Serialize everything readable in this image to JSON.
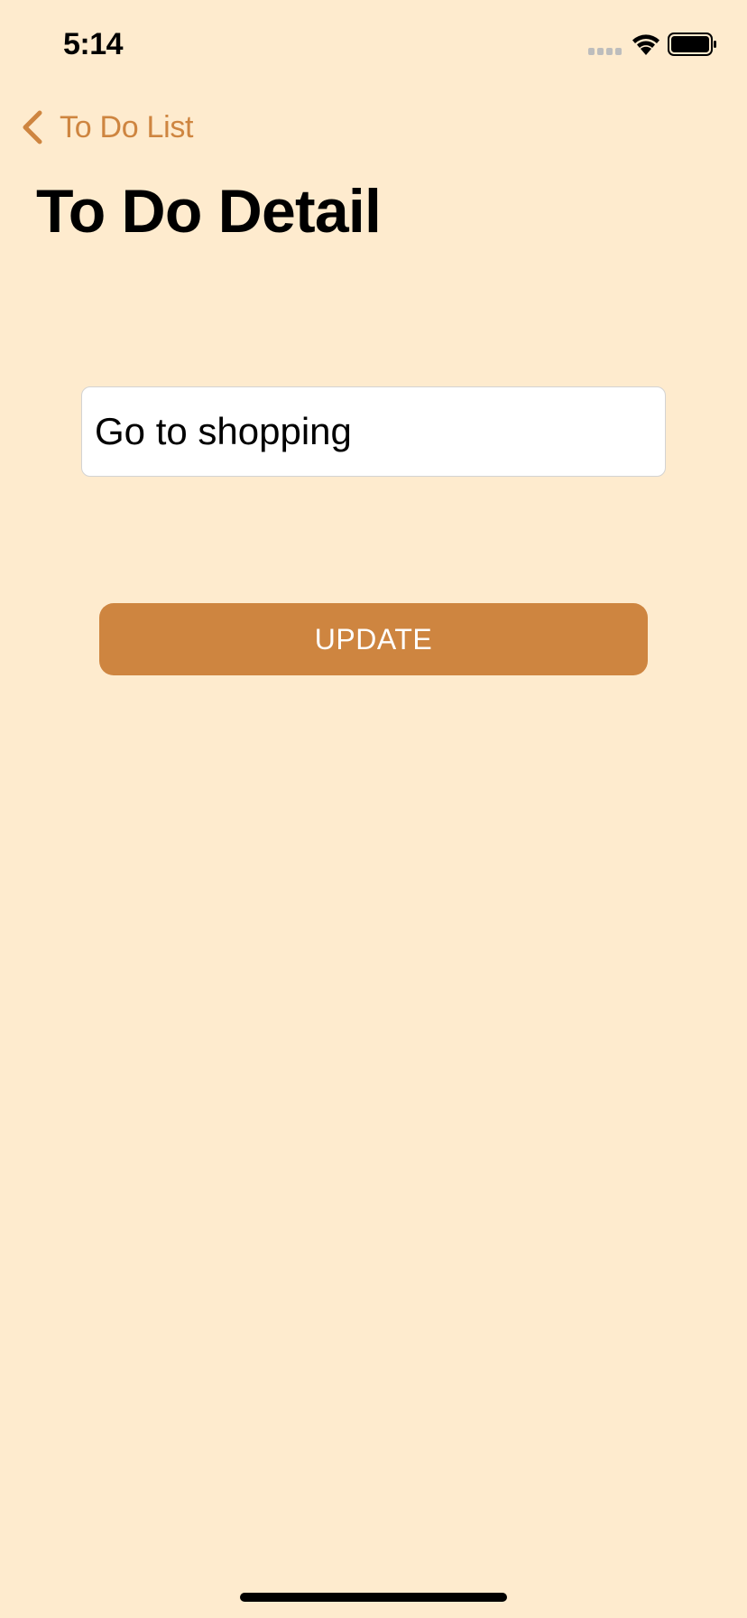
{
  "status_bar": {
    "time": "5:14",
    "icons": [
      "signal-icon",
      "wifi-icon",
      "battery-icon"
    ]
  },
  "nav": {
    "back_label": "To Do List",
    "back_icon": "chevron-left-icon"
  },
  "page": {
    "title": "To Do Detail"
  },
  "form": {
    "todo_value": "Go to shopping",
    "update_label": "UPDATE"
  },
  "colors": {
    "background": "#FEEBCE",
    "accent": "#CE8540",
    "button_text": "#FFFFFF"
  }
}
